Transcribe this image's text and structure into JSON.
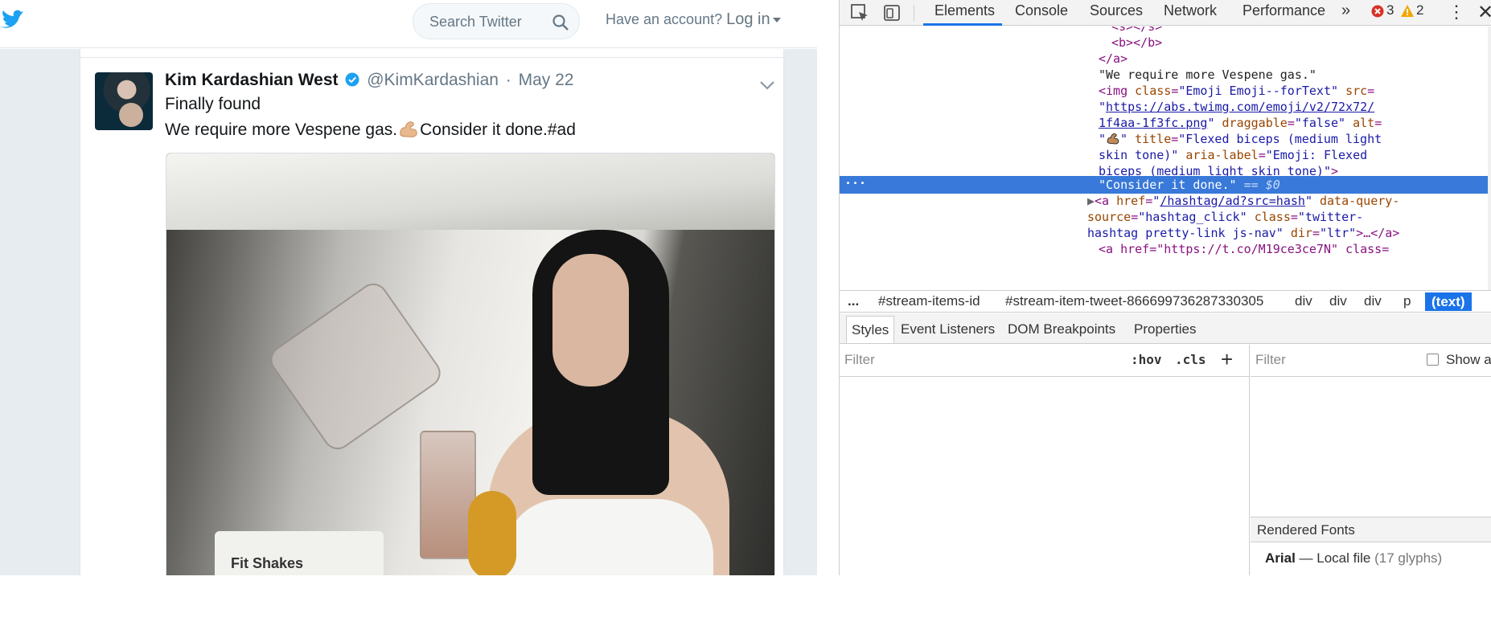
{
  "twitter": {
    "search_placeholder": "Search Twitter",
    "account_prompt": "Have an account?",
    "login_label": "Log in",
    "tweet": {
      "name": "Kim Kardashian West",
      "handle": "@KimKardashian",
      "separator": "·",
      "date": "May 22",
      "line1": "Finally found",
      "line2_before": "We require more Vespene gas.",
      "line2_after": "Consider it done.#ad",
      "photo_bag_text": "Fit Shakes"
    },
    "colors": {
      "brand": "#1da1f2",
      "link": "#1da1f2"
    }
  },
  "devtools": {
    "tabs": [
      "Elements",
      "Console",
      "Sources",
      "Network",
      "Performance"
    ],
    "more_tabs": "»",
    "error_count": "3",
    "warning_count": "2",
    "dom_lines": {
      "l1": "<s></s>",
      "l2": "<b></b>",
      "l3": "</a>",
      "l4": "\"We require more Vespene gas.\"",
      "l5_tag": "<img",
      "l5_attr1": "class",
      "l5_val1": "\"Emoji Emoji--forText\"",
      "l5_attr2": "src",
      "l6_url": "https://abs.twimg.com/emoji/v2/72x72/",
      "l7_url": "1f4aa-1f3fc.png",
      "l7_attr": "draggable",
      "l7_val": "\"false\"",
      "l7_attr2": "alt",
      "l8_q": "\"",
      "l8_q2": "\"",
      "l8_attr": "title",
      "l8_val": "\"Flexed biceps (medium light",
      "l9_val": "skin tone)\"",
      "l9_attr": "aria-label",
      "l9_val2": "\"Emoji: Flexed",
      "l10_val": "biceps (medium light skin tone)\"",
      "l10_close": ">",
      "selected_text": "\"Consider it done.\"",
      "selected_suffix": "== $0",
      "l12_tag": "<a",
      "l12_attr": "href",
      "l12_link": "/hashtag/ad?src=hash",
      "l12_attr2": "data-query-",
      "l13_attr": "source",
      "l13_val": "\"hashtag_click\"",
      "l13_attr2": "class",
      "l13_val2": "\"twitter-",
      "l14_val": "hashtag pretty-link js-nav\"",
      "l14_attr": "dir",
      "l14_val2": "\"ltr\"",
      "l14_rest": ">…</a>",
      "l15": "<a href=\"https://t.co/M19ce3ce7N\" class="
    },
    "breadcrumb": [
      "...",
      "#stream-items-id",
      "#stream-item-tweet-866699736287330305",
      "div",
      "div",
      "div",
      "p",
      "(text)"
    ],
    "panel_tabs": [
      "Styles",
      "Event Listeners",
      "DOM Breakpoints",
      "Properties"
    ],
    "styles_filter_placeholder": "Filter",
    "hov": ":hov",
    "cls": ".cls",
    "add_rule": "+",
    "computed_filter_placeholder": "Filter",
    "show_all_label": "Show a",
    "rendered_fonts_title": "Rendered Fonts",
    "font_name": "Arial",
    "font_dash": "—",
    "font_source": "Local file",
    "font_glyphs": "(17 glyphs)",
    "colors": {
      "selection": "#3879d9",
      "active_crumb": "#1a73e8",
      "error": "#d93025",
      "warning": "#f2a600"
    }
  }
}
